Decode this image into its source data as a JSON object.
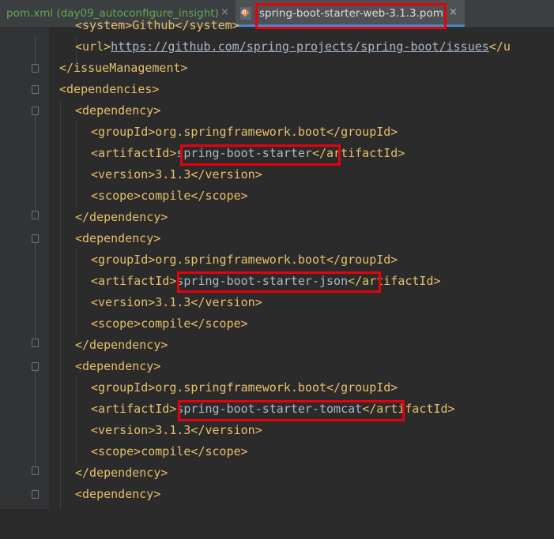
{
  "tabs": [
    {
      "label": "pom.xml (day09_autoconfigure_insight)",
      "close": "×"
    },
    {
      "label": "spring-boot-starter-web-3.1.3.pom",
      "close": "×"
    }
  ],
  "code": {
    "line0": "<system>Github</system>",
    "line1_open": "<url>",
    "line1_link": "https://github.com/spring-projects/spring-boot/issues",
    "line1_close": "</u",
    "line2": "</issueManagement>",
    "line3": "<dependencies>",
    "line4": "<dependency>",
    "line5": "<groupId>org.springframework.boot</groupId>",
    "line6_open": "<artifactId>",
    "line6_value": "spring-boot-starter",
    "line6_close": "</artifactId>",
    "line7": "<version>3.1.3</version>",
    "line8": "<scope>compile</scope>",
    "line9": "</dependency>",
    "line10": "<dependency>",
    "line11": "<groupId>org.springframework.boot</groupId>",
    "line12_open": "<artifactId>",
    "line12_value": "spring-boot-starter-json",
    "line12_close": "</artifactId>",
    "line13": "<version>3.1.3</version>",
    "line14": "<scope>compile</scope>",
    "line15": "</dependency>",
    "line16": "<dependency>",
    "line17": "<groupId>org.springframework.boot</groupId>",
    "line18_open": "<artifactId>",
    "line18_value": "spring-boot-starter-tomcat",
    "line18_close": "</artifactId>",
    "line19": "<version>3.1.3</version>",
    "line20": "<scope>compile</scope>",
    "line21": "</dependency>",
    "line22": "<dependency>"
  },
  "colors": {
    "tag": "#e8bf6a",
    "text": "#a9b7c6",
    "highlight_box": "#e8000d",
    "active_tab": "#4e5254"
  },
  "icons": {
    "pom_tab_icon": "maven-pom-icon",
    "close": "close-icon"
  }
}
